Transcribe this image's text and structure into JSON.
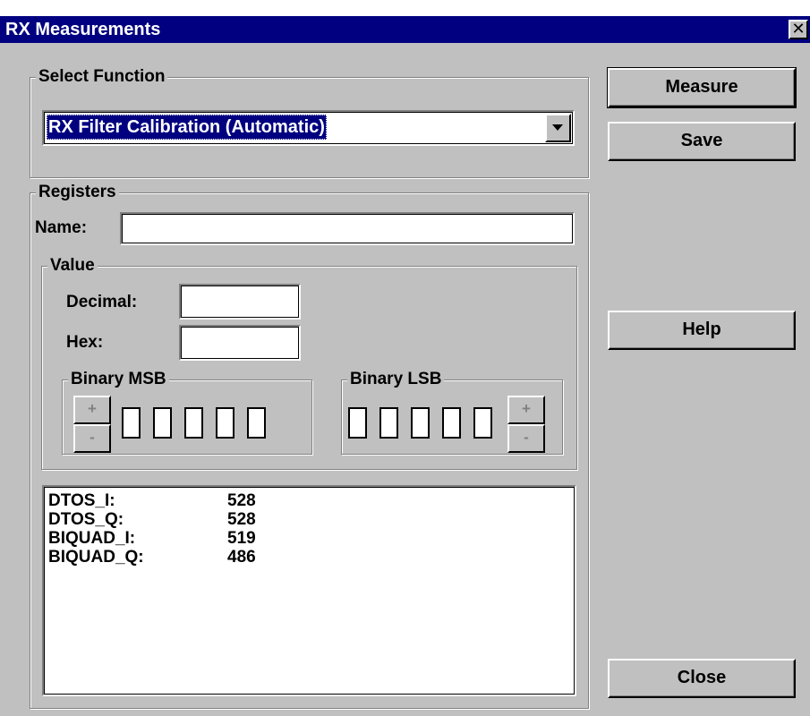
{
  "window": {
    "title": "RX Measurements",
    "close_glyph": "✕"
  },
  "select_function": {
    "legend": "Select Function",
    "selected_value": "RX Filter Calibration (Automatic)"
  },
  "registers": {
    "legend": "Registers",
    "name_label": "Name:",
    "name_value": "",
    "value_group": {
      "legend": "Value",
      "decimal_label": "Decimal:",
      "decimal_value": "",
      "hex_label": "Hex:",
      "hex_value": "",
      "binary_msb_legend": "Binary MSB",
      "binary_lsb_legend": "Binary LSB",
      "plus": "+",
      "minus": "-"
    }
  },
  "results": [
    {
      "name": "DTOS_I:",
      "value": "528"
    },
    {
      "name": "DTOS_Q:",
      "value": "528"
    },
    {
      "name": "BIQUAD_I:",
      "value": "519"
    },
    {
      "name": "BIQUAD_Q:",
      "value": "486"
    }
  ],
  "buttons": {
    "measure": "Measure",
    "save": "Save",
    "help": "Help",
    "close": "Close"
  },
  "icons": {
    "dropdown": "triangle-down",
    "close": "x"
  },
  "colors": {
    "title_bar": "#000080",
    "face": "#c0c0c0",
    "selection": "#000080"
  }
}
